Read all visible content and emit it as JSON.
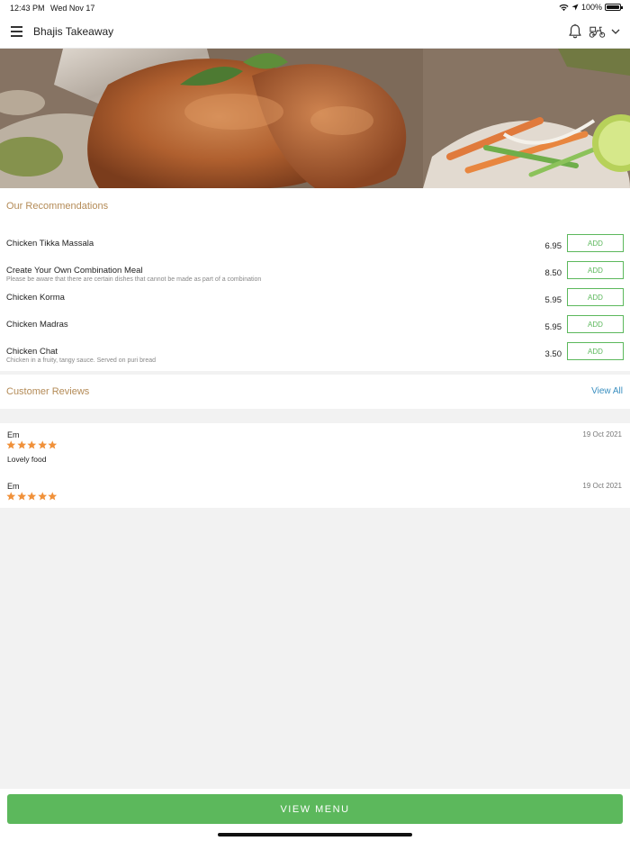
{
  "status_bar": {
    "time": "12:43 PM",
    "date": "Wed Nov 17",
    "battery": "100%",
    "icons": [
      "wifi-icon",
      "location-arrow-icon",
      "battery-icon"
    ]
  },
  "header": {
    "title": "Bhajis Takeaway",
    "icons": [
      "hamburger-menu-icon",
      "bell-icon",
      "scooter-icon",
      "chevron-down-icon"
    ]
  },
  "hero": {
    "image": "tandoori-chicken-photo"
  },
  "recommendations": {
    "title": "Our Recommendations",
    "items": [
      {
        "name": "Chicken Tikka Massala",
        "description": "",
        "price": "6.95",
        "button": "ADD"
      },
      {
        "name": "Create Your Own Combination Meal",
        "description": "Please be aware that there are certain dishes that cannot be made as part of a combination",
        "price": "8.50",
        "button": "ADD"
      },
      {
        "name": "Chicken Korma",
        "description": "",
        "price": "5.95",
        "button": "ADD"
      },
      {
        "name": "Chicken Madras",
        "description": "",
        "price": "5.95",
        "button": "ADD"
      },
      {
        "name": "Chicken Chat",
        "description": "Chicken in a fruity, tangy sauce. Served on puri bread",
        "price": "3.50",
        "button": "ADD"
      }
    ]
  },
  "reviews": {
    "title": "Customer Reviews",
    "view_all": "View All",
    "items": [
      {
        "reviewer": "Em",
        "date": "19 Oct 2021",
        "rating": 5,
        "comment": "Lovely food"
      },
      {
        "reviewer": "Em",
        "date": "19 Oct 2021",
        "rating": 5,
        "comment": ""
      }
    ]
  },
  "footer": {
    "view_menu": "VIEW MENU"
  },
  "colors": {
    "accent_green": "#5cb85c",
    "section_title": "#b48b57",
    "link_blue": "#3a8fc0",
    "star_orange": "#f0913a"
  }
}
